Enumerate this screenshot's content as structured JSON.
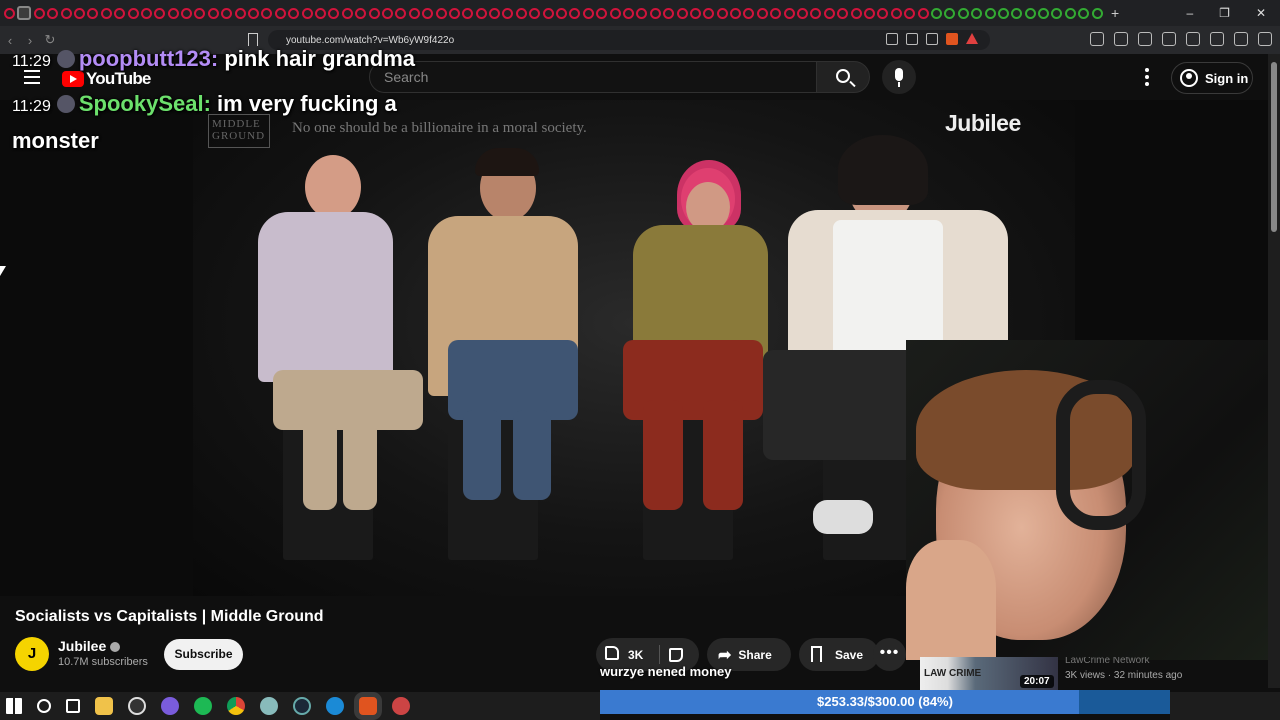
{
  "browser": {
    "url": "youtube.com/watch?v=Wb6yW9f422o",
    "new_tab": "+",
    "window_controls": [
      "–",
      "❐",
      "✕"
    ]
  },
  "youtube": {
    "logo_text": "YouTube",
    "search_placeholder": "Search",
    "sign_in": "Sign in"
  },
  "video": {
    "caption": "No one should be a billionaire in a moral society.",
    "show_logo": "MIDDLE GROUND",
    "watermark": "Jubilee",
    "title": "Socialists vs Capitalists | Middle Ground"
  },
  "chat": [
    {
      "time": "11:29",
      "user": "poopbutt123",
      "message": "pink hair grandma",
      "color": "#b38cf5"
    },
    {
      "time": "11:29",
      "user": "SpookySeal",
      "message": "im very fucking a monster",
      "color": "#6ce06c"
    }
  ],
  "channel": {
    "avatar_letter": "J",
    "name": "Jubilee",
    "subscribers": "10.7M subscribers",
    "subscribe": "Subscribe"
  },
  "actions": {
    "likes": "3K",
    "share": "Share",
    "save": "Save",
    "more": "•••"
  },
  "donor_line": "wurzye nened money",
  "recommendation": {
    "thumb_label": "LAW CRIME",
    "duration": "20:07",
    "channel": "LawCrime Network",
    "meta": "3K views · 32 minutes ago"
  },
  "donation": {
    "text": "$253.33/$300.00 (84%)",
    "progress": 0.84
  }
}
